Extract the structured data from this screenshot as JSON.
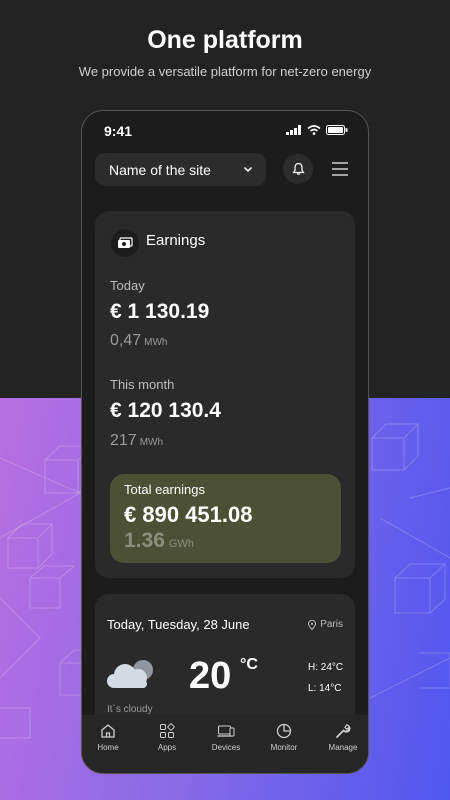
{
  "headline": "One platform",
  "subline": "We provide a versatile platform for net-zero energy",
  "status_bar": {
    "time": "9:41"
  },
  "header": {
    "site_selector": "Name of the site"
  },
  "earnings": {
    "title": "Earnings",
    "today_label": "Today",
    "today_value": "€ 1 130.19",
    "today_energy": "0,47",
    "today_unit": "MWh",
    "month_label": "This month",
    "month_value": "€ 120 130.4",
    "month_energy": "217",
    "month_unit": "MWh",
    "total_label": "Total earnings",
    "total_value": "€ 890 451.08",
    "total_energy": "1.36",
    "total_unit": "GWh"
  },
  "weather": {
    "date": "Today, Tuesday, 28 June",
    "location": "Paris",
    "temperature": "20",
    "temp_unit": "°C",
    "high": "H: 24°C",
    "low": "L: 14°C",
    "description": "It`s cloudy"
  },
  "tabs": [
    {
      "label": "Home",
      "icon": "home-icon"
    },
    {
      "label": "Apps",
      "icon": "apps-icon"
    },
    {
      "label": "Devices",
      "icon": "devices-icon"
    },
    {
      "label": "Monitor",
      "icon": "monitor-icon"
    },
    {
      "label": "Manage",
      "icon": "wrench-icon"
    }
  ],
  "colors": {
    "background_dark": "#232323",
    "gradient_start": "#b86ee0",
    "gradient_end": "#4f57f0",
    "card": "#2a2a2a",
    "total_card": "#4c5035"
  }
}
